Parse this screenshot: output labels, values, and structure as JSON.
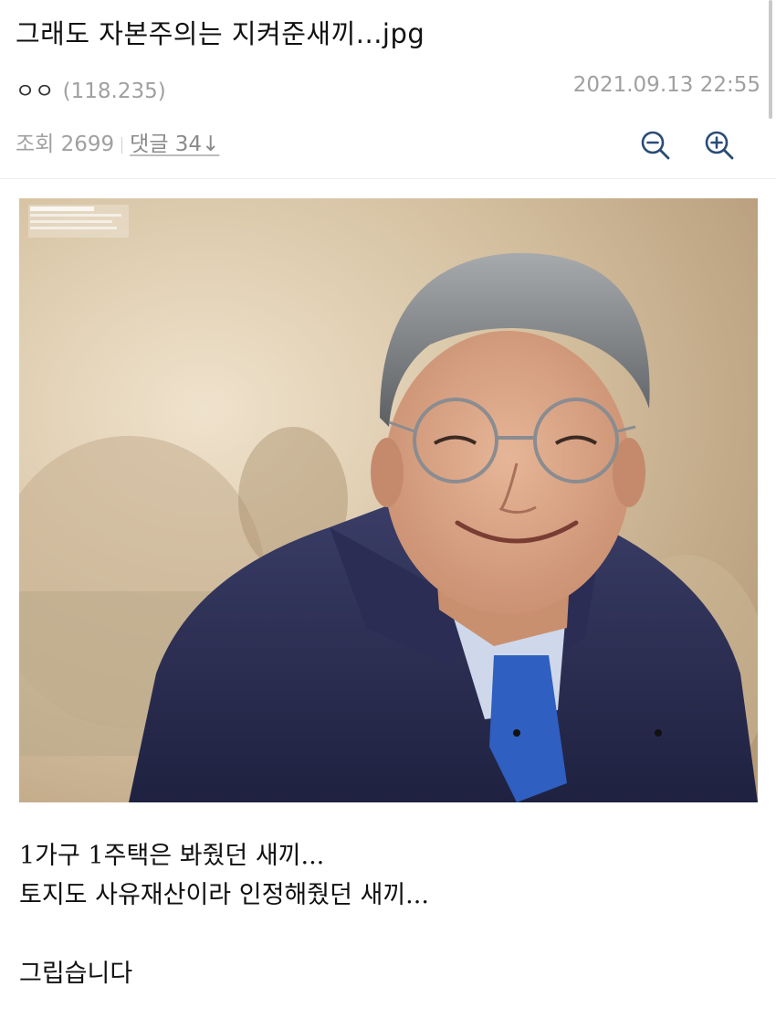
{
  "post": {
    "title": "그래도 자본주의는 지켜준새끼...jpg",
    "author_name": "ㅇㅇ",
    "author_ip": "(118.235)",
    "date": "2021.09.13 22:55",
    "views_label": "조회 2699",
    "comments_label": "댓글 34",
    "comments_arrow": "↓"
  },
  "image": {
    "icon": "portrait-photo",
    "description_colors": {
      "background": "#cdb89a",
      "jacket": "#2d2f52",
      "skin": "#d7a486",
      "hair": "#8c8f93"
    }
  },
  "body": {
    "lines": [
      "1가구 1주택은 봐줬던 새끼...",
      "토지도 사유재산이라 인정해줬던 새끼...",
      "",
      "그립습니다"
    ]
  },
  "icons": {
    "zoom_out": "zoom-out-icon",
    "zoom_in": "zoom-in-icon"
  }
}
